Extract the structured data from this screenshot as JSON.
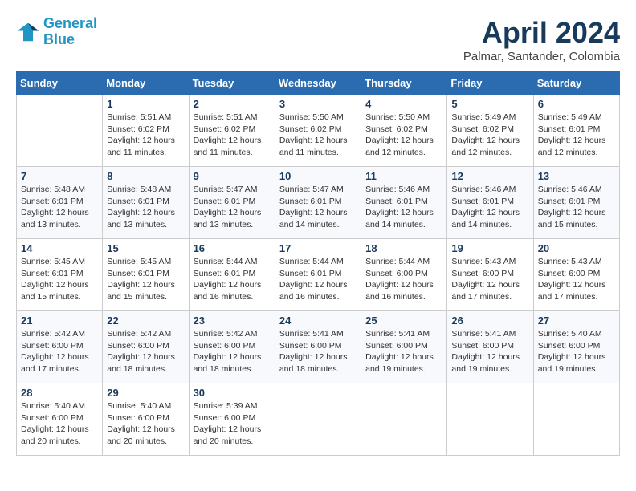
{
  "header": {
    "logo_line1": "General",
    "logo_line2": "Blue",
    "month": "April 2024",
    "location": "Palmar, Santander, Colombia"
  },
  "days_of_week": [
    "Sunday",
    "Monday",
    "Tuesday",
    "Wednesday",
    "Thursday",
    "Friday",
    "Saturday"
  ],
  "weeks": [
    [
      {
        "day": "",
        "info": ""
      },
      {
        "day": "1",
        "info": "Sunrise: 5:51 AM\nSunset: 6:02 PM\nDaylight: 12 hours\nand 11 minutes."
      },
      {
        "day": "2",
        "info": "Sunrise: 5:51 AM\nSunset: 6:02 PM\nDaylight: 12 hours\nand 11 minutes."
      },
      {
        "day": "3",
        "info": "Sunrise: 5:50 AM\nSunset: 6:02 PM\nDaylight: 12 hours\nand 11 minutes."
      },
      {
        "day": "4",
        "info": "Sunrise: 5:50 AM\nSunset: 6:02 PM\nDaylight: 12 hours\nand 12 minutes."
      },
      {
        "day": "5",
        "info": "Sunrise: 5:49 AM\nSunset: 6:02 PM\nDaylight: 12 hours\nand 12 minutes."
      },
      {
        "day": "6",
        "info": "Sunrise: 5:49 AM\nSunset: 6:01 PM\nDaylight: 12 hours\nand 12 minutes."
      }
    ],
    [
      {
        "day": "7",
        "info": "Sunrise: 5:48 AM\nSunset: 6:01 PM\nDaylight: 12 hours\nand 13 minutes."
      },
      {
        "day": "8",
        "info": "Sunrise: 5:48 AM\nSunset: 6:01 PM\nDaylight: 12 hours\nand 13 minutes."
      },
      {
        "day": "9",
        "info": "Sunrise: 5:47 AM\nSunset: 6:01 PM\nDaylight: 12 hours\nand 13 minutes."
      },
      {
        "day": "10",
        "info": "Sunrise: 5:47 AM\nSunset: 6:01 PM\nDaylight: 12 hours\nand 14 minutes."
      },
      {
        "day": "11",
        "info": "Sunrise: 5:46 AM\nSunset: 6:01 PM\nDaylight: 12 hours\nand 14 minutes."
      },
      {
        "day": "12",
        "info": "Sunrise: 5:46 AM\nSunset: 6:01 PM\nDaylight: 12 hours\nand 14 minutes."
      },
      {
        "day": "13",
        "info": "Sunrise: 5:46 AM\nSunset: 6:01 PM\nDaylight: 12 hours\nand 15 minutes."
      }
    ],
    [
      {
        "day": "14",
        "info": "Sunrise: 5:45 AM\nSunset: 6:01 PM\nDaylight: 12 hours\nand 15 minutes."
      },
      {
        "day": "15",
        "info": "Sunrise: 5:45 AM\nSunset: 6:01 PM\nDaylight: 12 hours\nand 15 minutes."
      },
      {
        "day": "16",
        "info": "Sunrise: 5:44 AM\nSunset: 6:01 PM\nDaylight: 12 hours\nand 16 minutes."
      },
      {
        "day": "17",
        "info": "Sunrise: 5:44 AM\nSunset: 6:01 PM\nDaylight: 12 hours\nand 16 minutes."
      },
      {
        "day": "18",
        "info": "Sunrise: 5:44 AM\nSunset: 6:00 PM\nDaylight: 12 hours\nand 16 minutes."
      },
      {
        "day": "19",
        "info": "Sunrise: 5:43 AM\nSunset: 6:00 PM\nDaylight: 12 hours\nand 17 minutes."
      },
      {
        "day": "20",
        "info": "Sunrise: 5:43 AM\nSunset: 6:00 PM\nDaylight: 12 hours\nand 17 minutes."
      }
    ],
    [
      {
        "day": "21",
        "info": "Sunrise: 5:42 AM\nSunset: 6:00 PM\nDaylight: 12 hours\nand 17 minutes."
      },
      {
        "day": "22",
        "info": "Sunrise: 5:42 AM\nSunset: 6:00 PM\nDaylight: 12 hours\nand 18 minutes."
      },
      {
        "day": "23",
        "info": "Sunrise: 5:42 AM\nSunset: 6:00 PM\nDaylight: 12 hours\nand 18 minutes."
      },
      {
        "day": "24",
        "info": "Sunrise: 5:41 AM\nSunset: 6:00 PM\nDaylight: 12 hours\nand 18 minutes."
      },
      {
        "day": "25",
        "info": "Sunrise: 5:41 AM\nSunset: 6:00 PM\nDaylight: 12 hours\nand 19 minutes."
      },
      {
        "day": "26",
        "info": "Sunrise: 5:41 AM\nSunset: 6:00 PM\nDaylight: 12 hours\nand 19 minutes."
      },
      {
        "day": "27",
        "info": "Sunrise: 5:40 AM\nSunset: 6:00 PM\nDaylight: 12 hours\nand 19 minutes."
      }
    ],
    [
      {
        "day": "28",
        "info": "Sunrise: 5:40 AM\nSunset: 6:00 PM\nDaylight: 12 hours\nand 20 minutes."
      },
      {
        "day": "29",
        "info": "Sunrise: 5:40 AM\nSunset: 6:00 PM\nDaylight: 12 hours\nand 20 minutes."
      },
      {
        "day": "30",
        "info": "Sunrise: 5:39 AM\nSunset: 6:00 PM\nDaylight: 12 hours\nand 20 minutes."
      },
      {
        "day": "",
        "info": ""
      },
      {
        "day": "",
        "info": ""
      },
      {
        "day": "",
        "info": ""
      },
      {
        "day": "",
        "info": ""
      }
    ]
  ]
}
